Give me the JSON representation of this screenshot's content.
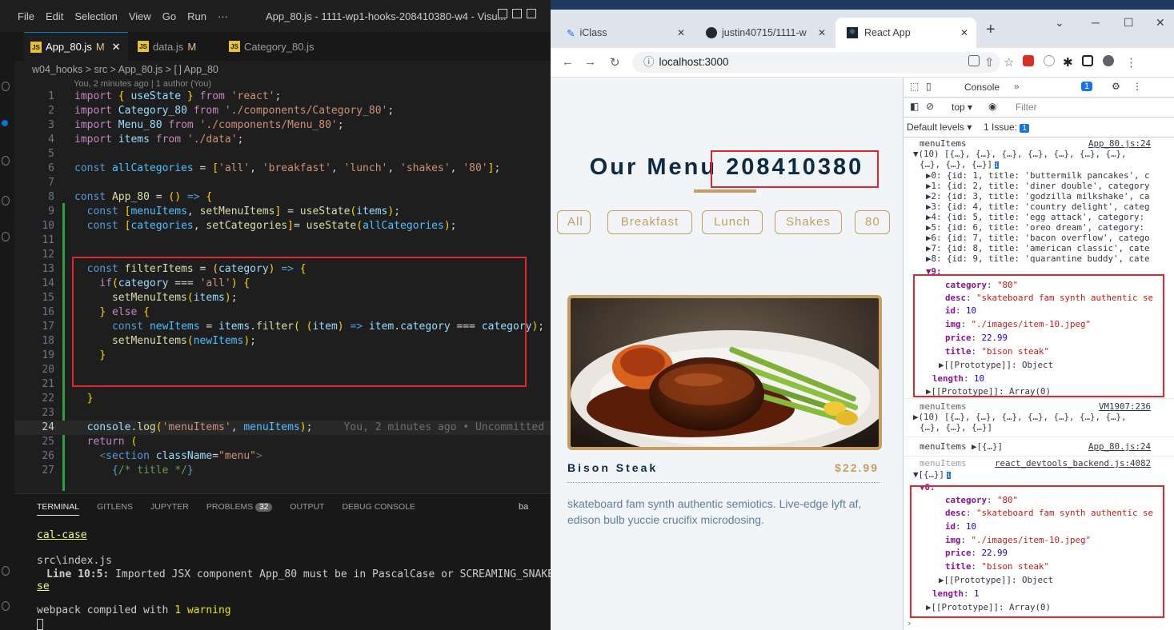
{
  "vscode": {
    "menu": [
      "File",
      "Edit",
      "Selection",
      "View",
      "Go",
      "Run",
      "···"
    ],
    "window_title": "App_80.js - 1111-wp1-hooks-208410380-w4 - Visu...",
    "tabs": [
      {
        "label": "App_80.js",
        "status": "M"
      },
      {
        "label": "data.js",
        "status": "M"
      },
      {
        "label": "Category_80.js",
        "status": ""
      }
    ],
    "breadcrumb": "w04_hooks > src > App_80.js > [ ] App_80",
    "blame": "You, 2 minutes ago | 1 author (You)",
    "code_line_numbers": [
      "1",
      "2",
      "3",
      "4",
      "5",
      "6",
      "7",
      "8",
      "9",
      "10",
      "11",
      "12",
      "13",
      "14",
      "15",
      "16",
      "17",
      "18",
      "19",
      "20",
      "21",
      "22",
      "23",
      "24",
      "25",
      "26",
      "27"
    ],
    "inline_blame": "You, 2 minutes ago • Uncommitted c",
    "panel_tabs": [
      "TERMINAL",
      "GITLENS",
      "JUPYTER",
      "PROBLEMS",
      "OUTPUT",
      "DEBUG CONSOLE"
    ],
    "problems_count": "32",
    "panel_right": "ba",
    "terminal": {
      "line1": "cal-case",
      "line2": "src\\index.js",
      "line3_prefix": "Line 10:5:",
      "line3_text": "  Imported JSX component App_80 must be in PascalCase or SCREAMING_SNAKE_CASE",
      "line4": "se",
      "line5_prefix": "webpack compiled with ",
      "line5_count": "1 warning"
    }
  },
  "chrome": {
    "tabs": [
      "iClass",
      "justin40715/1111-w",
      "React App"
    ],
    "url": "localhost:3000"
  },
  "page": {
    "title_prefix": "Our Menu",
    "title_id": "208410380",
    "categories": [
      "All",
      "Breakfast",
      "Lunch",
      "Shakes",
      "80"
    ],
    "item": {
      "title": "Bison Steak",
      "price": "$22.99",
      "desc": "skateboard fam synth authentic semiotics. Live-edge lyft af, edison bulb yuccie crucifix microdosing."
    }
  },
  "devtools": {
    "tab_console": "Console",
    "issues_badge": "1",
    "context": "top",
    "filter_placeholder": "Filter",
    "default_levels": "Default levels",
    "issue_text": "1 Issue:",
    "issue_count": "1",
    "log1": {
      "label": "menuItems",
      "source": "App_80.js:24",
      "summary1": "(10) [{…}, {…}, {…}, {…}, {…}, {…}, {…},",
      "summary2": "{…}, {…}, {…}]",
      "rows": [
        "▶0: {id: 1, title: 'buttermilk pancakes', c",
        "▶1: {id: 2, title: 'diner double', category",
        "▶2: {id: 3, title: 'godzilla milkshake', ca",
        "▶3: {id: 4, title: 'country delight', categ",
        "▶4: {id: 5, title: 'egg attack', category:",
        "▶5: {id: 6, title: 'oreo dream', category:",
        "▶6: {id: 7, title: 'bacon overflow', catego",
        "▶7: {id: 8, title: 'american classic', cate",
        "▶8: {id: 9, title: 'quarantine buddy', cate"
      ],
      "expanded_key": "▼9:",
      "fields": [
        {
          "k": "category",
          "v": "\"80\"",
          "t": "s"
        },
        {
          "k": "desc",
          "v": "\"skateboard fam synth authentic se",
          "t": "s"
        },
        {
          "k": "id",
          "v": "10",
          "t": "n"
        },
        {
          "k": "img",
          "v": "\"./images/item-10.jpeg\"",
          "t": "s"
        },
        {
          "k": "price",
          "v": "22.99",
          "t": "n"
        },
        {
          "k": "title",
          "v": "\"bison steak\"",
          "t": "s"
        }
      ],
      "proto_obj": "▶[[Prototype]]: Object",
      "length": "10",
      "proto_arr": "▶[[Prototype]]: Array(0)"
    },
    "log2": {
      "label": "menuItems",
      "source": "VM1907:236",
      "summary1": "(10) [{…}, {…}, {…}, {…}, {…}, {…}, {…},",
      "summary2": "{…}, {…}, {…}]"
    },
    "log3": {
      "label": "menuItems ▶[{…}]",
      "source": "App_80.js:24"
    },
    "log4": {
      "label": "menuItems",
      "source": "react_devtools_backend.js:4082",
      "summary": "▼[{…}]",
      "expanded_key": "▼0:",
      "fields": [
        {
          "k": "category",
          "v": "\"80\"",
          "t": "s"
        },
        {
          "k": "desc",
          "v": "\"skateboard fam synth authentic se",
          "t": "s"
        },
        {
          "k": "id",
          "v": "10",
          "t": "n"
        },
        {
          "k": "img",
          "v": "\"./images/item-10.jpeg\"",
          "t": "s"
        },
        {
          "k": "price",
          "v": "22.99",
          "t": "n"
        },
        {
          "k": "title",
          "v": "\"bison steak\"",
          "t": "s"
        }
      ],
      "proto_obj": "▶[[Prototype]]: Object",
      "length": "1",
      "proto_arr": "▶[[Prototype]]: Array(0)"
    }
  }
}
